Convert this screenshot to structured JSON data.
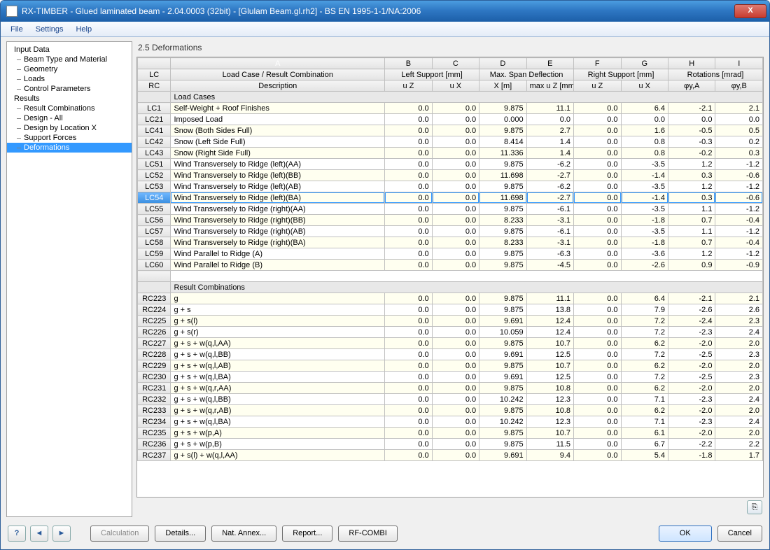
{
  "window": {
    "title": "RX-TIMBER - Glued laminated beam - 2.04.0003 (32bit) - [Glulam Beam.gl.rh2] - BS EN 1995-1-1/NA:2006",
    "close": "X"
  },
  "menu": {
    "file": "File",
    "settings": "Settings",
    "help": "Help"
  },
  "tree": {
    "input": "Input Data",
    "beamtype": "Beam Type and Material",
    "geometry": "Geometry",
    "loads": "Loads",
    "control": "Control Parameters",
    "results": "Results",
    "rc": "Result Combinations",
    "design_all": "Design - All",
    "design_loc": "Design by Location X",
    "support": "Support Forces",
    "deform": "Deformations"
  },
  "panel": {
    "title": "2.5 Deformations"
  },
  "columns": {
    "lc1": "LC",
    "lc2": "RC",
    "A": "A",
    "B": "B",
    "C": "C",
    "D": "D",
    "E": "E",
    "F": "F",
    "G": "G",
    "H": "H",
    "I": "I",
    "h1": "Load Case / Result Combination",
    "h2": "Description",
    "ls": "Left Support [mm]",
    "uz": "u Z",
    "ux": "u X",
    "msd": "Max. Span Deflection",
    "xm": "X [m]",
    "muz": "max u Z [mm]",
    "rs": "Right Support [mm]",
    "rot": "Rotations [mrad]",
    "phya": "φy,A",
    "phyb": "φy,B"
  },
  "sections": {
    "lc": "Load Cases",
    "rc": "Result Combinations"
  },
  "chart_data": {
    "type": "table",
    "columns": [
      "id",
      "Description",
      "Left uZ",
      "Left uX",
      "X [m]",
      "max uZ [mm]",
      "Right uZ",
      "Right uX",
      "φy,A",
      "φy,B"
    ],
    "load_cases": [
      {
        "id": "LC1",
        "d": "Self-Weight + Roof Finishes",
        "v": [
          "0.0",
          "0.0",
          "9.875",
          "11.1",
          "0.0",
          "6.4",
          "-2.1",
          "2.1"
        ]
      },
      {
        "id": "LC21",
        "d": "Imposed Load",
        "v": [
          "0.0",
          "0.0",
          "0.000",
          "0.0",
          "0.0",
          "0.0",
          "0.0",
          "0.0"
        ]
      },
      {
        "id": "LC41",
        "d": "Snow (Both Sides Full)",
        "v": [
          "0.0",
          "0.0",
          "9.875",
          "2.7",
          "0.0",
          "1.6",
          "-0.5",
          "0.5"
        ]
      },
      {
        "id": "LC42",
        "d": "Snow (Left Side Full)",
        "v": [
          "0.0",
          "0.0",
          "8.414",
          "1.4",
          "0.0",
          "0.8",
          "-0.3",
          "0.2"
        ]
      },
      {
        "id": "LC43",
        "d": "Snow (Right Side Full)",
        "v": [
          "0.0",
          "0.0",
          "11.336",
          "1.4",
          "0.0",
          "0.8",
          "-0.2",
          "0.3"
        ]
      },
      {
        "id": "LC51",
        "d": "Wind Transversely to Ridge (left)(AA)",
        "v": [
          "0.0",
          "0.0",
          "9.875",
          "-6.2",
          "0.0",
          "-3.5",
          "1.2",
          "-1.2"
        ]
      },
      {
        "id": "LC52",
        "d": "Wind Transversely to Ridge (left)(BB)",
        "v": [
          "0.0",
          "0.0",
          "11.698",
          "-2.7",
          "0.0",
          "-1.4",
          "0.3",
          "-0.6"
        ]
      },
      {
        "id": "LC53",
        "d": "Wind Transversely to Ridge (left)(AB)",
        "v": [
          "0.0",
          "0.0",
          "9.875",
          "-6.2",
          "0.0",
          "-3.5",
          "1.2",
          "-1.2"
        ]
      },
      {
        "id": "LC54",
        "d": "Wind Transversely to Ridge (left)(BA)",
        "v": [
          "0.0",
          "0.0",
          "11.698",
          "-2.7",
          "0.0",
          "-1.4",
          "0.3",
          "-0.6"
        ],
        "sel": true
      },
      {
        "id": "LC55",
        "d": "Wind Transversely to Ridge (right)(AA)",
        "v": [
          "0.0",
          "0.0",
          "9.875",
          "-6.1",
          "0.0",
          "-3.5",
          "1.1",
          "-1.2"
        ]
      },
      {
        "id": "LC56",
        "d": "Wind Transversely to Ridge (right)(BB)",
        "v": [
          "0.0",
          "0.0",
          "8.233",
          "-3.1",
          "0.0",
          "-1.8",
          "0.7",
          "-0.4"
        ]
      },
      {
        "id": "LC57",
        "d": "Wind Transversely to Ridge (right)(AB)",
        "v": [
          "0.0",
          "0.0",
          "9.875",
          "-6.1",
          "0.0",
          "-3.5",
          "1.1",
          "-1.2"
        ]
      },
      {
        "id": "LC58",
        "d": "Wind Transversely to Ridge (right)(BA)",
        "v": [
          "0.0",
          "0.0",
          "8.233",
          "-3.1",
          "0.0",
          "-1.8",
          "0.7",
          "-0.4"
        ]
      },
      {
        "id": "LC59",
        "d": "Wind Parallel to Ridge (A)",
        "v": [
          "0.0",
          "0.0",
          "9.875",
          "-6.3",
          "0.0",
          "-3.6",
          "1.2",
          "-1.2"
        ]
      },
      {
        "id": "LC60",
        "d": "Wind Parallel to Ridge (B)",
        "v": [
          "0.0",
          "0.0",
          "9.875",
          "-4.5",
          "0.0",
          "-2.6",
          "0.9",
          "-0.9"
        ]
      }
    ],
    "result_combinations": [
      {
        "id": "RC223",
        "d": "g",
        "v": [
          "0.0",
          "0.0",
          "9.875",
          "11.1",
          "0.0",
          "6.4",
          "-2.1",
          "2.1"
        ]
      },
      {
        "id": "RC224",
        "d": "g + s",
        "v": [
          "0.0",
          "0.0",
          "9.875",
          "13.8",
          "0.0",
          "7.9",
          "-2.6",
          "2.6"
        ]
      },
      {
        "id": "RC225",
        "d": "g + s(l)",
        "v": [
          "0.0",
          "0.0",
          "9.691",
          "12.4",
          "0.0",
          "7.2",
          "-2.4",
          "2.3"
        ]
      },
      {
        "id": "RC226",
        "d": "g + s(r)",
        "v": [
          "0.0",
          "0.0",
          "10.059",
          "12.4",
          "0.0",
          "7.2",
          "-2.3",
          "2.4"
        ]
      },
      {
        "id": "RC227",
        "d": "g + s + w(q,l,AA)",
        "v": [
          "0.0",
          "0.0",
          "9.875",
          "10.7",
          "0.0",
          "6.2",
          "-2.0",
          "2.0"
        ]
      },
      {
        "id": "RC228",
        "d": "g + s + w(q,l,BB)",
        "v": [
          "0.0",
          "0.0",
          "9.691",
          "12.5",
          "0.0",
          "7.2",
          "-2.5",
          "2.3"
        ]
      },
      {
        "id": "RC229",
        "d": "g + s + w(q,l,AB)",
        "v": [
          "0.0",
          "0.0",
          "9.875",
          "10.7",
          "0.0",
          "6.2",
          "-2.0",
          "2.0"
        ]
      },
      {
        "id": "RC230",
        "d": "g + s + w(q,l,BA)",
        "v": [
          "0.0",
          "0.0",
          "9.691",
          "12.5",
          "0.0",
          "7.2",
          "-2.5",
          "2.3"
        ]
      },
      {
        "id": "RC231",
        "d": "g + s + w(q,r,AA)",
        "v": [
          "0.0",
          "0.0",
          "9.875",
          "10.8",
          "0.0",
          "6.2",
          "-2.0",
          "2.0"
        ]
      },
      {
        "id": "RC232",
        "d": "g + s + w(q,l,BB)",
        "v": [
          "0.0",
          "0.0",
          "10.242",
          "12.3",
          "0.0",
          "7.1",
          "-2.3",
          "2.4"
        ]
      },
      {
        "id": "RC233",
        "d": "g + s + w(q,r,AB)",
        "v": [
          "0.0",
          "0.0",
          "9.875",
          "10.8",
          "0.0",
          "6.2",
          "-2.0",
          "2.0"
        ]
      },
      {
        "id": "RC234",
        "d": "g + s + w(q,l,BA)",
        "v": [
          "0.0",
          "0.0",
          "10.242",
          "12.3",
          "0.0",
          "7.1",
          "-2.3",
          "2.4"
        ]
      },
      {
        "id": "RC235",
        "d": "g + s + w(p,A)",
        "v": [
          "0.0",
          "0.0",
          "9.875",
          "10.7",
          "0.0",
          "6.1",
          "-2.0",
          "2.0"
        ]
      },
      {
        "id": "RC236",
        "d": "g + s + w(p,B)",
        "v": [
          "0.0",
          "0.0",
          "9.875",
          "11.5",
          "0.0",
          "6.7",
          "-2.2",
          "2.2"
        ]
      },
      {
        "id": "RC237",
        "d": "g + s(l) + w(q,l,AA)",
        "v": [
          "0.0",
          "0.0",
          "9.691",
          "9.4",
          "0.0",
          "5.4",
          "-1.8",
          "1.7"
        ]
      }
    ]
  },
  "buttons": {
    "calc": "Calculation",
    "details": "Details...",
    "nat": "Nat. Annex...",
    "report": "Report...",
    "rf": "RF-COMBI",
    "ok": "OK",
    "cancel": "Cancel"
  }
}
